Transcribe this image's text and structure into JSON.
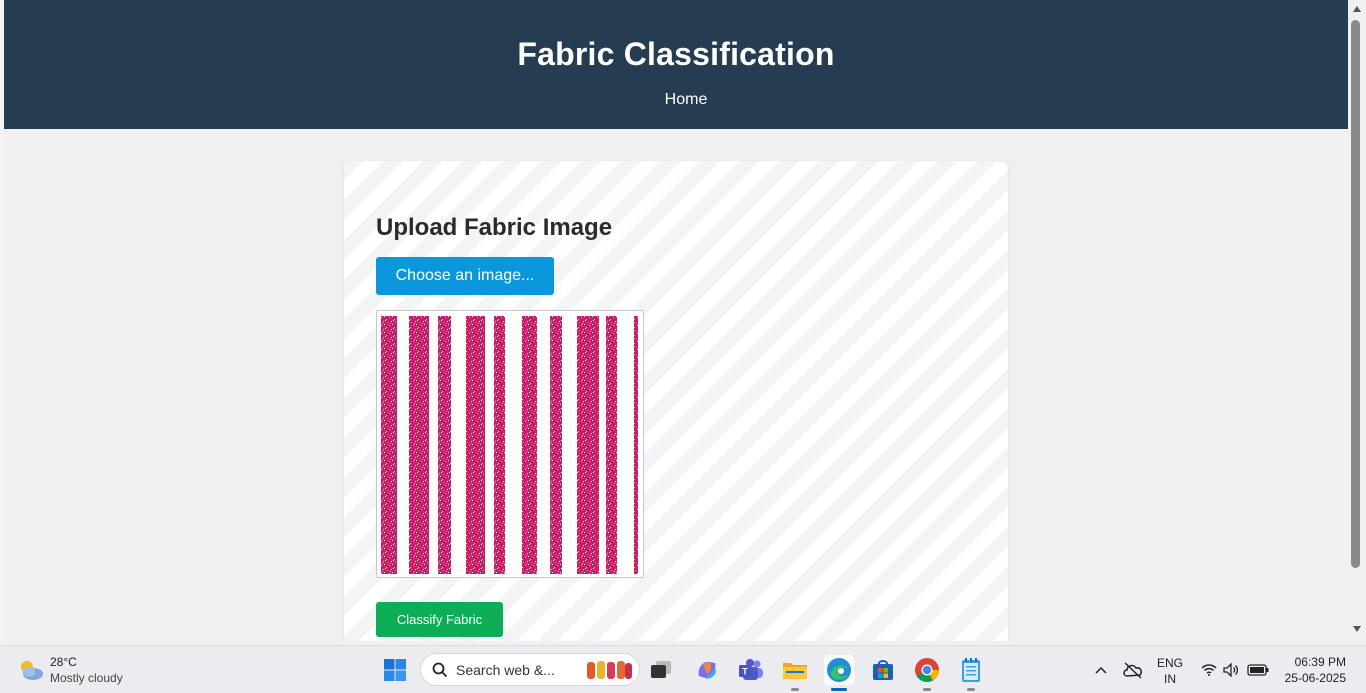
{
  "header": {
    "title": "Fabric Classification",
    "nav_home": "Home"
  },
  "upload": {
    "title": "Upload Fabric Image",
    "choose_label": "Choose an image...",
    "classify_label": "Classify Fabric"
  },
  "colors": {
    "header_bg": "#263d51",
    "choose_button": "#0a97dc",
    "classify_button": "#0cad56",
    "stripe_magenta": "#c81e6e",
    "stripe_yellow": "#f0e020"
  },
  "taskbar": {
    "weather_temp": "28°C",
    "weather_desc": "Mostly cloudy",
    "search_placeholder": "Search web &...",
    "lang_top": "ENG",
    "lang_bottom": "IN",
    "time": "06:39 PM",
    "date": "25-06-2025",
    "icons": [
      "windows-start-icon",
      "search-icon",
      "task-view-icon",
      "copilot-icon",
      "teams-icon",
      "file-explorer-icon",
      "edge-icon",
      "microsoft-store-icon",
      "chrome-icon",
      "notepad-icon"
    ]
  }
}
